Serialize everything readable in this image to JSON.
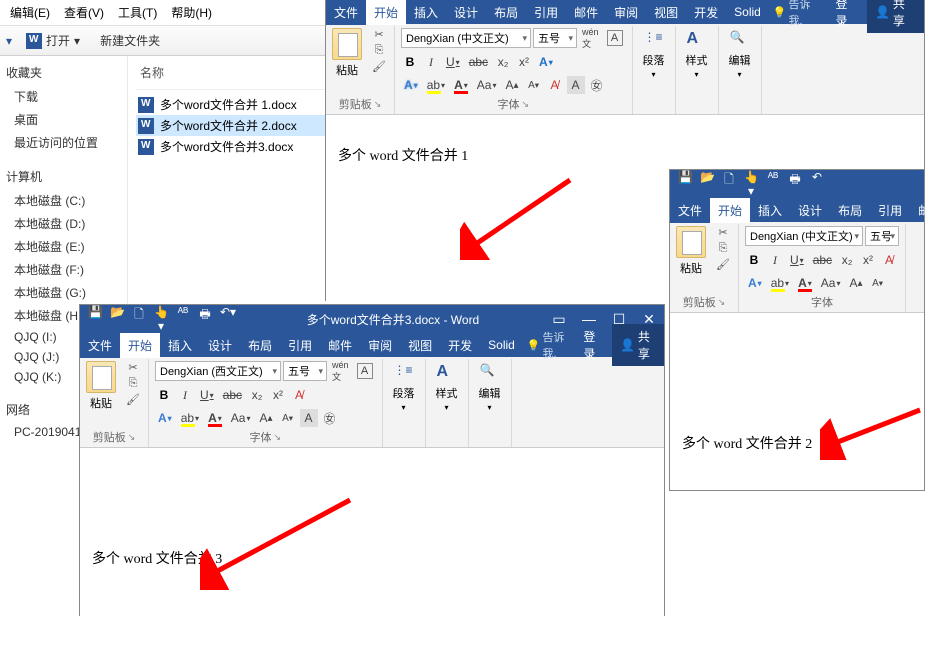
{
  "explorer": {
    "menu": [
      "编辑(E)",
      "查看(V)",
      "工具(T)",
      "帮助(H)"
    ],
    "open": "打开",
    "newFolder": "新建文件夹",
    "header_name": "名称",
    "nav": {
      "favorites": "收藏夹",
      "fav_items": [
        "下载",
        "桌面",
        "最近访问的位置"
      ],
      "computer": "计算机",
      "drives": [
        "本地磁盘 (C:)",
        "本地磁盘 (D:)",
        "本地磁盘 (E:)",
        "本地磁盘 (F:)",
        "本地磁盘 (G:)",
        "本地磁盘 (H:)",
        "QJQ (I:)",
        "QJQ (J:)",
        "QJQ (K:)"
      ],
      "network": "网络",
      "net_items": [
        "PC-2019041"
      ]
    },
    "files": [
      "多个word文件合并 1.docx",
      "多个word文件合并 2.docx",
      "多个word文件合并3.docx"
    ]
  },
  "word": {
    "tabs": [
      "文件",
      "开始",
      "插入",
      "设计",
      "布局",
      "引用",
      "邮件",
      "审阅",
      "视图",
      "开发",
      "Solid"
    ],
    "tell": "告诉我.",
    "login": "登录",
    "share": "共享",
    "paste": "粘贴",
    "groups": {
      "clipboard": "剪贴板",
      "font": "字体",
      "para": "段落",
      "styles": "样式",
      "editing": "编辑"
    },
    "fontname1": "DengXian (中文正文)",
    "fontname2": "DengXian (西文正文)",
    "fontname3": "DengXian (中文正文)",
    "fontsize": "五号",
    "title3": "多个word文件合并3.docx - Word",
    "doc1": "多个 word 文件合并  1",
    "doc2": "多个 word 文件合并  2",
    "doc3": "多个 word 文件合并  3"
  }
}
